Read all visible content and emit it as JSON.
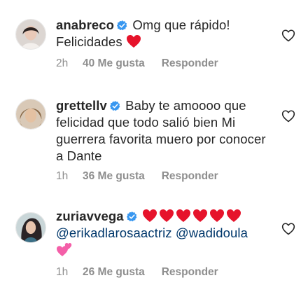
{
  "comments": [
    {
      "username": "anabreco",
      "text": "Omg que rápido! Felicidades",
      "emoji": "red-heart",
      "time": "2h",
      "likes": "40 Me gusta",
      "reply": "Responder"
    },
    {
      "username": "grettellv",
      "text": "Baby te amoooo que felicidad que todo salió bien Mi guerrera favorita muero por conocer a Dante",
      "time": "1h",
      "likes": "36 Me gusta",
      "reply": "Responder"
    },
    {
      "username": "zuriavvega",
      "emoji_row": "six-red-hearts",
      "mention1": "@erikadlarosaactriz",
      "mention2": "@wadidoula",
      "emoji_end": "two-pink-hearts",
      "time": "1h",
      "likes": "26 Me gusta",
      "reply": "Responder"
    }
  ],
  "colors": {
    "text": "#262626",
    "muted": "#8e8e8e",
    "mention": "#00376b",
    "verified": "#3897f0",
    "heart_red": "#e6132b",
    "heart_pink": "#f45fa8"
  },
  "icons": {
    "verified": "verified-badge-icon",
    "like": "heart-outline-icon"
  }
}
